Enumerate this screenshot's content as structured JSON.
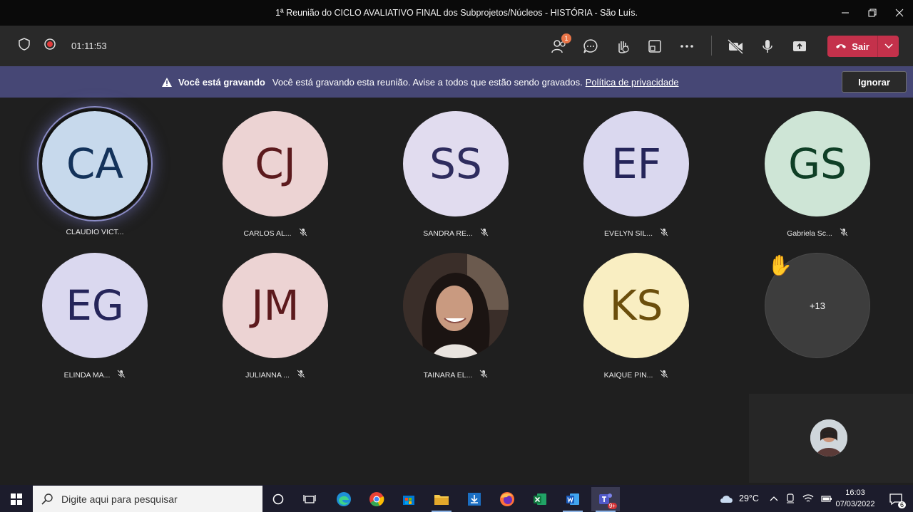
{
  "window": {
    "title": "1ª Reunião do CICLO AVALIATIVO FINAL dos Subprojetos/Núcleos - HISTÓRIA - São Luís."
  },
  "toolbar": {
    "timer": "01:11:53",
    "participants_badge": "1",
    "leave_label": "Sair"
  },
  "banner": {
    "bold": "Você está gravando",
    "message": "Você está gravando esta reunião. Avise a todos que estão sendo gravados.",
    "link": "Política de privacidade",
    "ignore_label": "Ignorar"
  },
  "participants": [
    {
      "initials": "CA",
      "name": "CLAUDIO VICT...",
      "bg": "#c7d9ec",
      "fg": "#13325a",
      "speaking": true,
      "muted": false
    },
    {
      "initials": "CJ",
      "name": "CARLOS AL...",
      "bg": "#ecd3d3",
      "fg": "#5c1a1d",
      "muted": true
    },
    {
      "initials": "SS",
      "name": "SANDRA RE...",
      "bg": "#e1dcef",
      "fg": "#2e2c5e",
      "muted": true
    },
    {
      "initials": "EF",
      "name": "EVELYN SIL...",
      "bg": "#dad8ef",
      "fg": "#25255a",
      "muted": true
    },
    {
      "initials": "GS",
      "name": "Gabriela Sc...",
      "bg": "#cee5d6",
      "fg": "#0f3f26",
      "muted": true
    },
    {
      "initials": "EG",
      "name": "ELINDA MA...",
      "bg": "#dad8ef",
      "fg": "#25255a",
      "muted": true
    },
    {
      "initials": "JM",
      "name": "JULIANNA ...",
      "bg": "#ecd3d3",
      "fg": "#5c1a1d",
      "muted": true
    },
    {
      "initials": "",
      "name": "TAINARA EL...",
      "bg": "#3b2f2b",
      "fg": "#fff",
      "photo": true,
      "muted": true
    },
    {
      "initials": "KS",
      "name": "KAIQUE PIN...",
      "bg": "#f9eec2",
      "fg": "#6b4e0c",
      "muted": true
    }
  ],
  "overflow": {
    "label": "+13"
  },
  "taskbar": {
    "search_placeholder": "Digite aqui para pesquisar",
    "temperature": "29°C",
    "time": "16:03",
    "date": "07/03/2022",
    "notifications": "6",
    "teams_badge": "9+"
  },
  "colors": {
    "accent": "#464775",
    "leave": "#c4314b",
    "badge": "#e97548"
  }
}
